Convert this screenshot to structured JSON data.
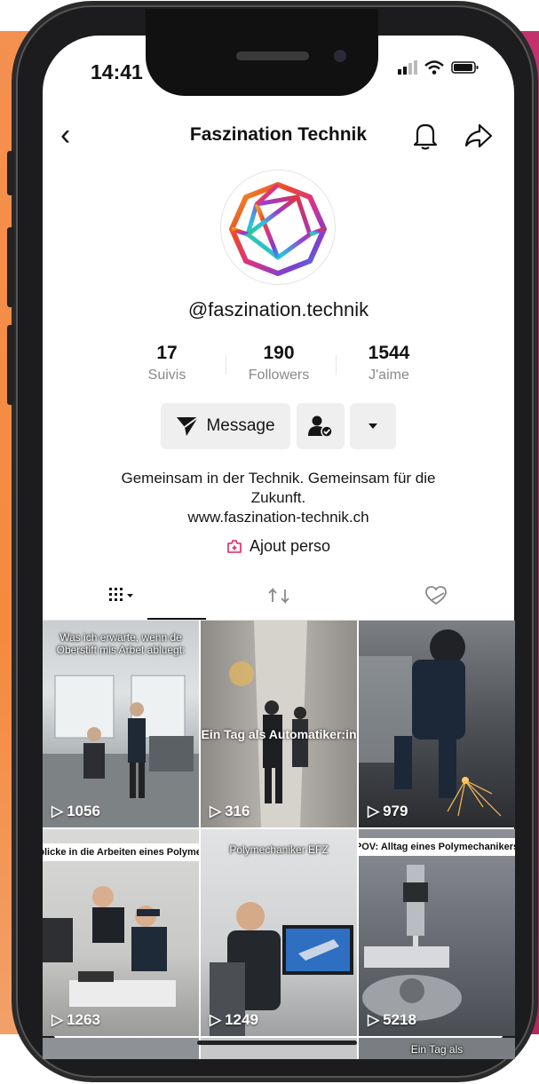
{
  "status_bar": {
    "time": "14:41"
  },
  "header": {
    "title": "Faszination Technik"
  },
  "profile": {
    "username": "@faszination.technik",
    "stats": [
      {
        "value": "17",
        "label": "Suivis"
      },
      {
        "value": "190",
        "label": "Followers"
      },
      {
        "value": "1544",
        "label": "J'aime"
      }
    ],
    "message_label": "Message",
    "bio_line1": "Gemeinsam in der Technik. Gemeinsam für die",
    "bio_line2": "Zukunft.",
    "website": "www.faszination-technik.ch",
    "ajout_label": "Ajout perso"
  },
  "tabs": [
    {
      "icon": "grid-icon"
    },
    {
      "icon": "repost-icon"
    },
    {
      "icon": "liked-hidden-icon"
    }
  ],
  "videos": [
    {
      "caption": "Was ich erwarte, wenn de Oberstift mis Arbet abluegt:",
      "views": "1056"
    },
    {
      "caption": "Ein Tag als Automatiker:in",
      "views": "316"
    },
    {
      "caption": "",
      "views": "979"
    },
    {
      "caption": "Einblicke in die Arbeiten eines Polymechs",
      "views": "1263"
    },
    {
      "caption": "Polymechaniker EFZ",
      "views": "1249"
    },
    {
      "caption": "POV: Alltag eines Polymechanikers",
      "views": "5218"
    }
  ],
  "partial_caption": "Ein Tag als"
}
